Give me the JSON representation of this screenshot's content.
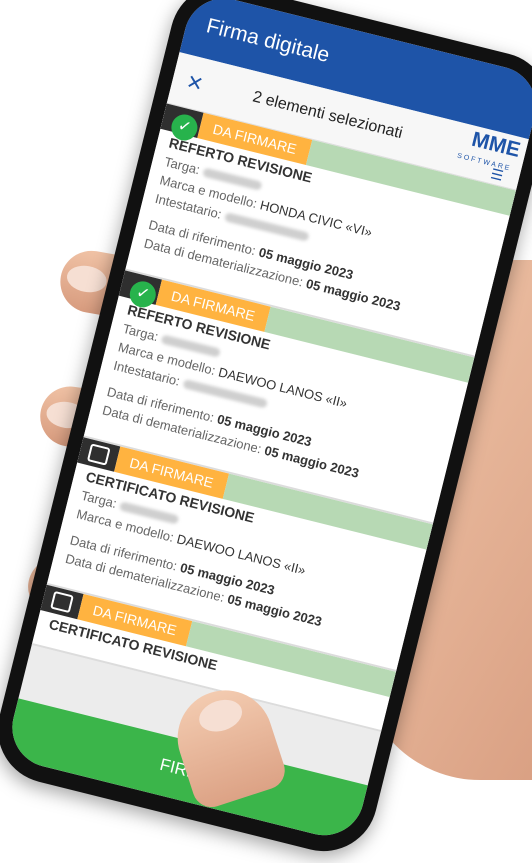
{
  "app": {
    "title": "Firma digitale"
  },
  "selection": {
    "count_text": "2 elementi selezionati"
  },
  "brand": {
    "logo_text": "MME",
    "logo_sub": "SOFTWARE"
  },
  "cards": [
    {
      "badge": "DA FIRMARE",
      "title": "REFERTO REVISIONE",
      "targa_label": "Targa:",
      "marca_label": "Marca e modello:",
      "marca_value": "HONDA CIVIC «VI»",
      "intestatario_label": "Intestatario:",
      "rif_label": "Data di riferimento:",
      "rif_value": "05 maggio 2023",
      "demat_label": "Data di dematerializzazione:",
      "demat_value": "05 maggio 2023",
      "selected": true
    },
    {
      "badge": "DA FIRMARE",
      "title": "REFERTO REVISIONE",
      "targa_label": "Targa:",
      "marca_label": "Marca e modello:",
      "marca_value": "DAEWOO LANOS «II»",
      "intestatario_label": "Intestatario:",
      "rif_label": "Data di riferimento:",
      "rif_value": "05 maggio 2023",
      "demat_label": "Data di dematerializzazione:",
      "demat_value": "05 maggio 2023",
      "selected": true
    },
    {
      "badge": "DA FIRMARE",
      "title": "CERTIFICATO REVISIONE",
      "targa_label": "Targa:",
      "marca_label": "Marca e modello:",
      "marca_value": "DAEWOO LANOS «II»",
      "rif_label": "Data di riferimento:",
      "rif_value": "05 maggio 2023",
      "demat_label": "Data di dematerializzazione:",
      "demat_value": "05 maggio 2023",
      "selected": false
    },
    {
      "badge": "DA FIRMARE",
      "title": "CERTIFICATO REVISIONE",
      "selected": false
    }
  ],
  "footer": {
    "button_label": "FIRMA"
  },
  "colors": {
    "primary": "#1e54a8",
    "badge": "#ffb340",
    "ok": "#27b34c",
    "button": "#3bb54a"
  }
}
